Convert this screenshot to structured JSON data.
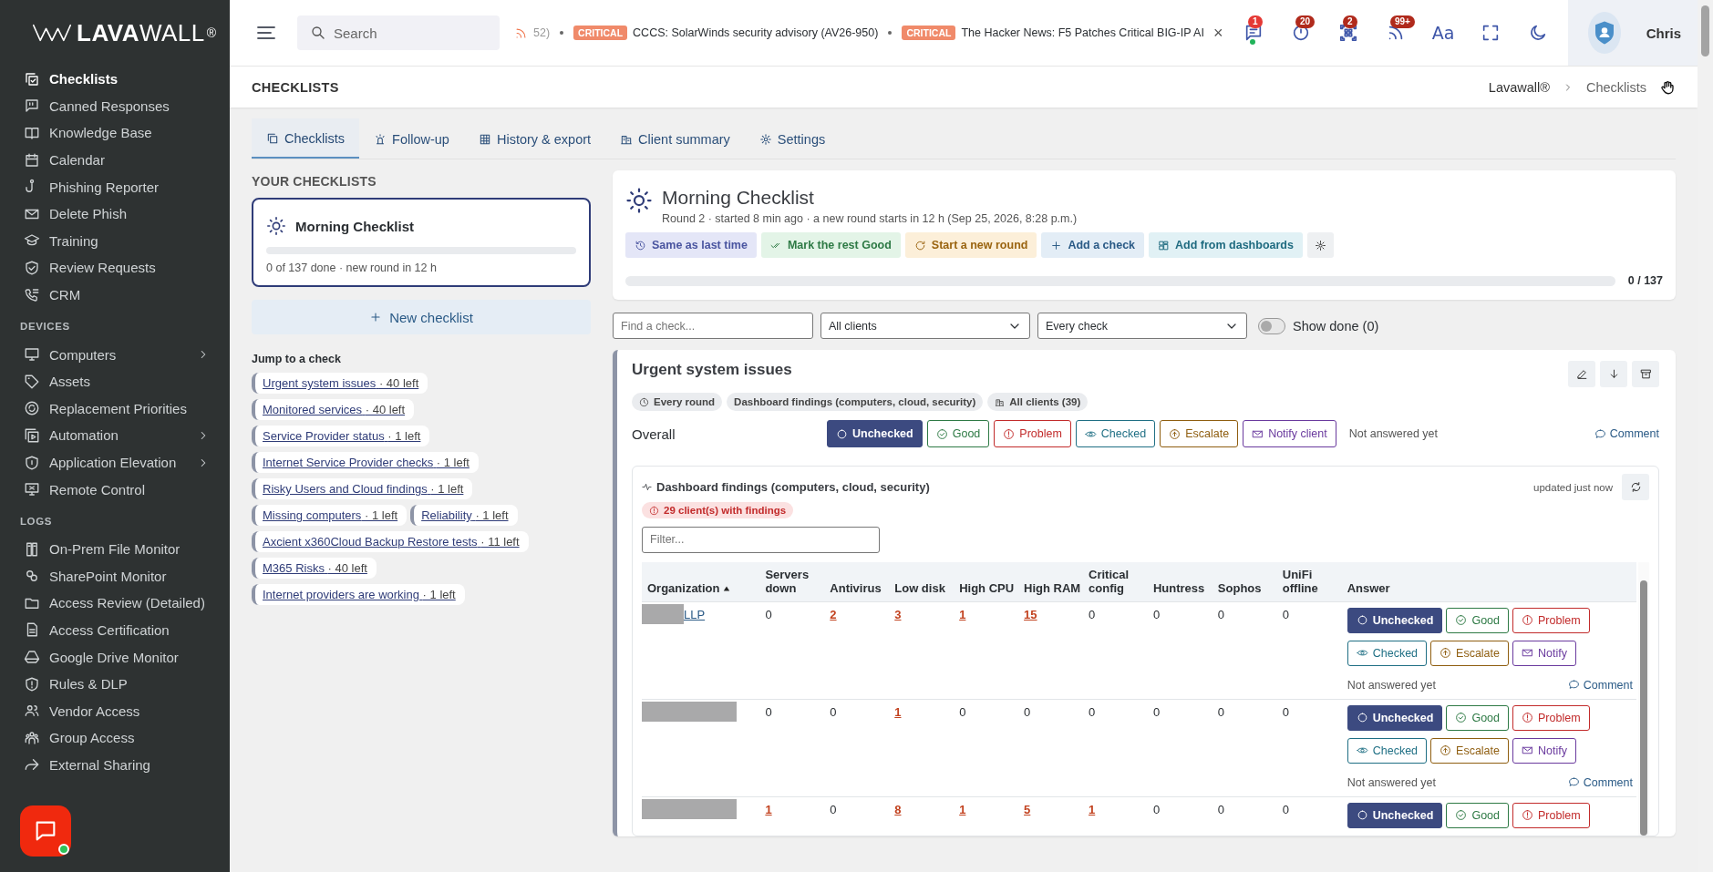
{
  "sidebar": {
    "logo": {
      "strong": "LAVA",
      "light": "WALL",
      "mark": "®"
    },
    "sections": [
      {
        "items": [
          {
            "label": "Checklists",
            "selected": true,
            "submenu": false
          },
          {
            "label": "Canned Responses",
            "selected": false,
            "submenu": false
          },
          {
            "label": "Knowledge Base",
            "selected": false,
            "submenu": false
          },
          {
            "label": "Calendar",
            "selected": false,
            "submenu": false
          },
          {
            "label": "Phishing Reporter",
            "selected": false,
            "submenu": false
          },
          {
            "label": "Delete Phish",
            "selected": false,
            "submenu": false
          },
          {
            "label": "Training",
            "selected": false,
            "submenu": false
          },
          {
            "label": "Review Requests",
            "selected": false,
            "submenu": false
          },
          {
            "label": "CRM",
            "selected": false,
            "submenu": false
          }
        ]
      },
      {
        "heading": "DEVICES",
        "items": [
          {
            "label": "Computers",
            "selected": false,
            "submenu": true
          },
          {
            "label": "Assets",
            "selected": false,
            "submenu": false
          },
          {
            "label": "Replacement Priorities",
            "selected": false,
            "submenu": false
          },
          {
            "label": "Automation",
            "selected": false,
            "submenu": true
          },
          {
            "label": "Application Elevation",
            "selected": false,
            "submenu": true
          },
          {
            "label": "Remote Control",
            "selected": false,
            "submenu": false
          }
        ]
      },
      {
        "heading": "LOGS",
        "items": [
          {
            "label": "On-Prem File Monitor",
            "selected": false,
            "submenu": false
          },
          {
            "label": "SharePoint Monitor",
            "selected": false,
            "submenu": false
          },
          {
            "label": "Access Review (Detailed)",
            "selected": false,
            "submenu": false
          },
          {
            "label": "Access Certification",
            "selected": false,
            "submenu": false
          },
          {
            "label": "Google Drive Monitor",
            "selected": false,
            "submenu": false
          },
          {
            "label": "Rules & DLP",
            "selected": false,
            "submenu": false
          },
          {
            "label": "Vendor Access",
            "selected": false,
            "submenu": false
          },
          {
            "label": "Group Access",
            "selected": false,
            "submenu": false
          },
          {
            "label": "External Sharing",
            "selected": false,
            "submenu": false
          }
        ]
      }
    ]
  },
  "topbar": {
    "search": {
      "placeholder": "Search"
    },
    "ticker": {
      "lead": "52)",
      "items": [
        {
          "badge": "CRITICAL",
          "text": "CCCS: SolarWinds security advisory (AV26-950)"
        },
        {
          "badge": "CRITICAL",
          "text": "The Hacker News: F5 Patches Critical BIG-IP AI"
        }
      ],
      "close": "×"
    },
    "badges": [
      "1",
      "20",
      "2",
      "99+"
    ],
    "font_button": "Aa",
    "user": "Chris"
  },
  "header": {
    "title": "CHECKLISTS",
    "breadcrumb": [
      "Lavawall®",
      "Checklists"
    ]
  },
  "tabs": [
    {
      "label": "Checklists",
      "selected": true
    },
    {
      "label": "Follow-up",
      "selected": false
    },
    {
      "label": "History & export",
      "selected": false
    },
    {
      "label": "Client summary",
      "selected": false
    },
    {
      "label": "Settings",
      "selected": false
    }
  ],
  "left": {
    "heading": "YOUR CHECKLISTS",
    "checklists": [
      {
        "title": "Morning Checklist",
        "level": 0,
        "meta": "0 of 137 done · new round in 12 h",
        "selected": true
      }
    ],
    "new_button": "New checklist",
    "jump_heading": "Jump to a check",
    "jumps": [
      {
        "label": "Urgent system issues",
        "count": "· 40 left"
      },
      {
        "label": "Monitored services",
        "count": "· 40 left"
      },
      {
        "label": "Service Provider status",
        "count": "· 1 left"
      },
      {
        "label": "Internet Service Provider checks",
        "count": "· 1 left"
      },
      {
        "label": "Risky Users and Cloud findings",
        "count": "· 1 left"
      },
      {
        "label": "Missing computers",
        "count": "· 1 left"
      },
      {
        "label": "Reliability",
        "count": "· 1 left"
      },
      {
        "label": "Axcient x360Cloud Backup Restore tests",
        "count": "· 11 left"
      },
      {
        "label": "M365 Risks",
        "count": "· 40 left"
      },
      {
        "label": "Internet providers are working",
        "count": "· 1 left"
      }
    ]
  },
  "checklist": {
    "title": "Morning Checklist",
    "subtitle": "Round 2 · started 8 min ago · a new round starts in 12 h (Sep 25, 2026, 8:28 p.m.)",
    "actions": [
      {
        "label": "Same as last time",
        "kind": "history"
      },
      {
        "label": "Mark the rest Good",
        "kind": "good"
      },
      {
        "label": "Start a new round",
        "kind": "round"
      },
      {
        "label": "Add a check",
        "kind": "add"
      },
      {
        "label": "Add from dashboards",
        "kind": "dashboard"
      }
    ],
    "level": 0,
    "progress": "0 / 137"
  },
  "filters": {
    "find": {
      "placeholder": "Find a check..."
    },
    "selects": [
      "All clients",
      "Every check"
    ],
    "show_done": {
      "label": "Show done (0)",
      "on": false
    }
  },
  "check": {
    "title": "Urgent system issues",
    "tags": [
      "Every round",
      "Dashboard findings (computers, cloud, security)",
      "All clients (39)"
    ],
    "overall": {
      "label": "Overall",
      "answers": [
        {
          "label": "Unchecked",
          "kind": "unchecked",
          "selected": true
        },
        {
          "label": "Good",
          "kind": "good",
          "selected": false
        },
        {
          "label": "Problem",
          "kind": "problem",
          "selected": false
        },
        {
          "label": "Checked",
          "kind": "checked",
          "selected": false
        },
        {
          "label": "Escalate",
          "kind": "escalate",
          "selected": false
        },
        {
          "label": "Notify client",
          "kind": "notify",
          "selected": false
        }
      ],
      "status": "Not answered yet",
      "comment": "Comment"
    },
    "findings": {
      "title": "Dashboard findings (computers, cloud, security)",
      "updated": "updated just now",
      "badge": "29 client(s) with findings",
      "filter": {
        "placeholder": "Filter..."
      },
      "columns": [
        {
          "label": "Organization",
          "sorted": true
        },
        {
          "label": "Servers down"
        },
        {
          "label": "Antivirus"
        },
        {
          "label": "Low disk"
        },
        {
          "label": "High CPU"
        },
        {
          "label": "High RAM"
        },
        {
          "label": "Critical config"
        },
        {
          "label": "Huntress"
        },
        {
          "label": "Sophos"
        },
        {
          "label": "UniFi offline"
        },
        {
          "label": "Answer"
        }
      ],
      "rows": [
        {
          "org": "LLP",
          "values": [
            {
              "v": "0",
              "alert": false
            },
            {
              "v": "2",
              "alert": true
            },
            {
              "v": "3",
              "alert": true
            },
            {
              "v": "1",
              "alert": true
            },
            {
              "v": "15",
              "alert": true
            },
            {
              "v": "0",
              "alert": false
            },
            {
              "v": "0",
              "alert": false
            },
            {
              "v": "0",
              "alert": false
            },
            {
              "v": "0",
              "alert": false
            }
          ],
          "answers": [
            {
              "label": "Unchecked",
              "kind": "unchecked",
              "selected": true
            },
            {
              "label": "Good",
              "kind": "good",
              "selected": false
            },
            {
              "label": "Problem",
              "kind": "problem",
              "selected": false
            },
            {
              "label": "Checked",
              "kind": "checked",
              "selected": false
            },
            {
              "label": "Escalate",
              "kind": "escalate",
              "selected": false
            },
            {
              "label": "Notify",
              "kind": "notify",
              "selected": false
            }
          ],
          "status": "Not answered yet",
          "comment": "Comment"
        },
        {
          "values": [
            {
              "v": "0",
              "alert": false
            },
            {
              "v": "0",
              "alert": false
            },
            {
              "v": "1",
              "alert": true
            },
            {
              "v": "0",
              "alert": false
            },
            {
              "v": "0",
              "alert": false
            },
            {
              "v": "0",
              "alert": false
            },
            {
              "v": "0",
              "alert": false
            },
            {
              "v": "0",
              "alert": false
            },
            {
              "v": "0",
              "alert": false
            }
          ],
          "answers": [
            {
              "label": "Unchecked",
              "kind": "unchecked",
              "selected": true
            },
            {
              "label": "Good",
              "kind": "good",
              "selected": false
            },
            {
              "label": "Problem",
              "kind": "problem",
              "selected": false
            },
            {
              "label": "Checked",
              "kind": "checked",
              "selected": false
            },
            {
              "label": "Escalate",
              "kind": "escalate",
              "selected": false
            },
            {
              "label": "Notify",
              "kind": "notify",
              "selected": false
            }
          ],
          "status": "Not answered yet",
          "comment": "Comment"
        },
        {
          "values": [
            {
              "v": "1",
              "alert": true
            },
            {
              "v": "0",
              "alert": false
            },
            {
              "v": "8",
              "alert": true
            },
            {
              "v": "1",
              "alert": true
            },
            {
              "v": "5",
              "alert": true
            },
            {
              "v": "1",
              "alert": true
            },
            {
              "v": "0",
              "alert": false
            },
            {
              "v": "0",
              "alert": false
            },
            {
              "v": "0",
              "alert": false
            }
          ],
          "answers": [
            {
              "label": "Unchecked",
              "kind": "unchecked",
              "selected": true
            },
            {
              "label": "Good",
              "kind": "good",
              "selected": false
            },
            {
              "label": "Problem",
              "kind": "problem",
              "selected": false
            }
          ]
        }
      ]
    }
  }
}
